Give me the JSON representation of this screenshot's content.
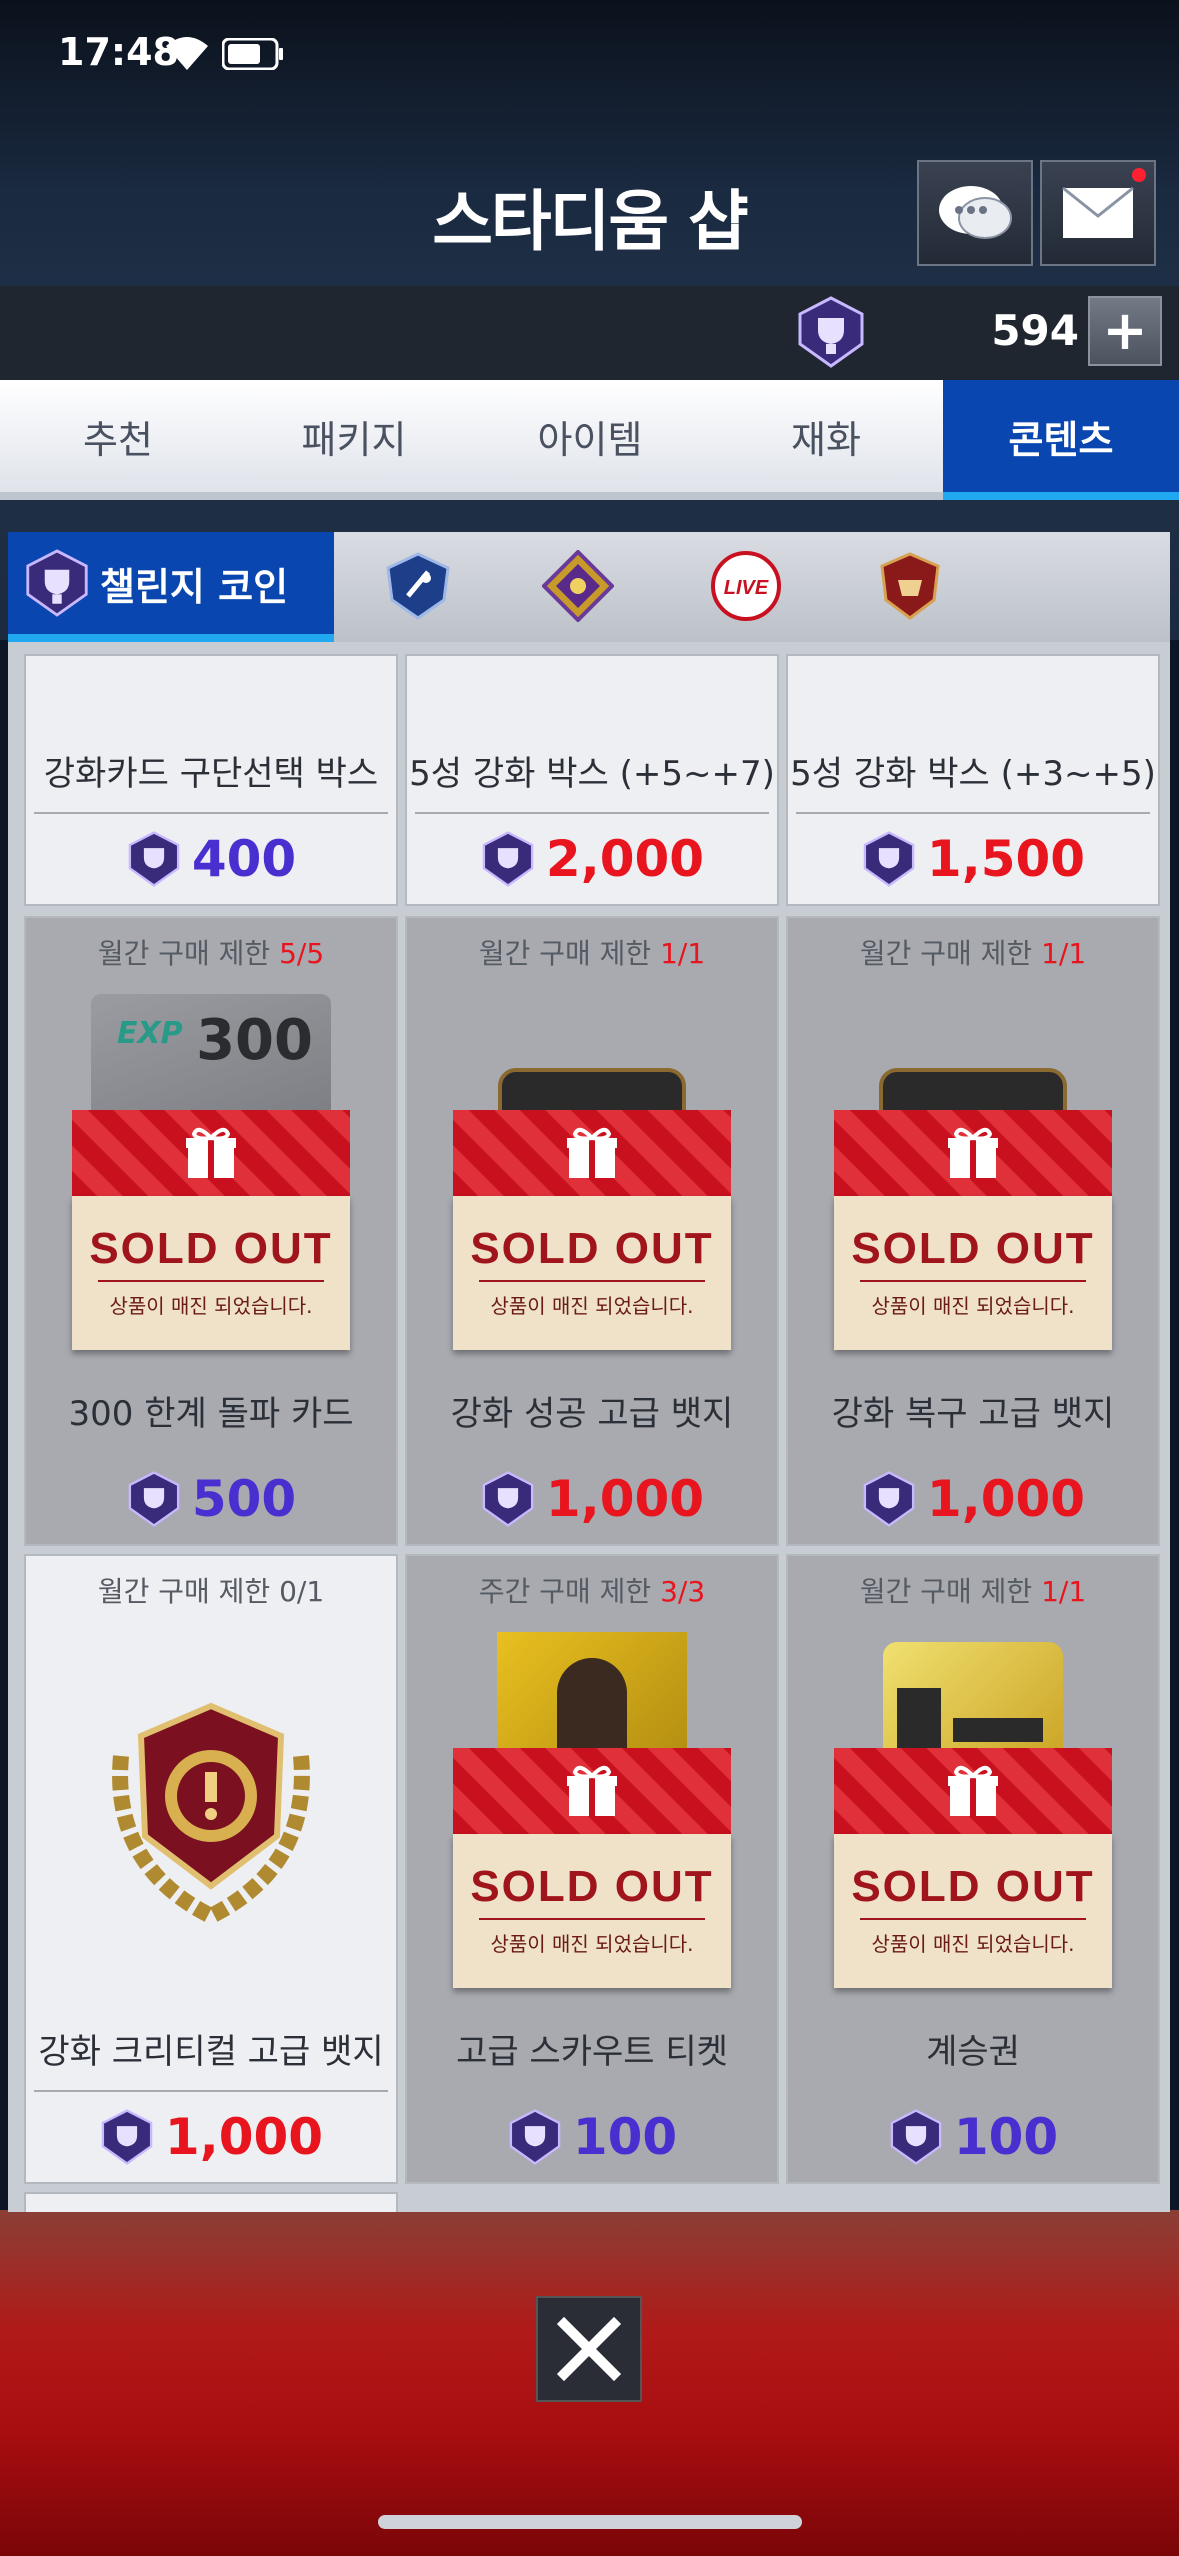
{
  "status": {
    "time": "17:48"
  },
  "header": {
    "title": "스타디움 샵"
  },
  "currency": {
    "amount": "594",
    "plus": "+"
  },
  "tabs": [
    {
      "label": "추천"
    },
    {
      "label": "패키지"
    },
    {
      "label": "아이템"
    },
    {
      "label": "재화"
    },
    {
      "label": "콘텐츠",
      "active": true
    }
  ],
  "subtabs": {
    "active_label": "챌린지 코인",
    "others": [
      "blue-crest-icon",
      "gold-purple-crest-icon",
      "live-badge-icon",
      "red-crest-icon"
    ],
    "live_text": "LIVE"
  },
  "items": [
    {
      "name": "강화카드 구단선택 박스",
      "price": "400",
      "price_color": "purple",
      "limit": "",
      "sold_out": false
    },
    {
      "name": "5성 강화 박스 (+5~+7)",
      "price": "2,000",
      "price_color": "red",
      "limit": "",
      "sold_out": false
    },
    {
      "name": "5성 강화 박스 (+3~+5)",
      "price": "1,500",
      "price_color": "red",
      "limit": "",
      "sold_out": false
    },
    {
      "name": "300 한계 돌파 카드",
      "price": "500",
      "price_color": "purple",
      "limit_label": "월간 구매 제한 ",
      "limit_used": "5",
      "limit_max": "5",
      "sold_out": true,
      "art_text": "300",
      "art_exp": "EXP"
    },
    {
      "name": "강화 성공 고급 뱃지",
      "price": "1,000",
      "price_color": "red",
      "limit_label": "월간 구매 제한 ",
      "limit_used": "1",
      "limit_max": "1",
      "sold_out": true
    },
    {
      "name": "강화 복구 고급 뱃지",
      "price": "1,000",
      "price_color": "red",
      "limit_label": "월간 구매 제한 ",
      "limit_used": "1",
      "limit_max": "1",
      "sold_out": true
    },
    {
      "name": "강화 크리티컬 고급 뱃지",
      "price": "1,000",
      "price_color": "red",
      "limit_text": "월간 구매 제한 0/1",
      "sold_out": false
    },
    {
      "name": "고급 스카우트 티켓",
      "price": "100",
      "price_color": "purple",
      "limit_label": "주간 구매 제한 ",
      "limit_used": "3",
      "limit_max": "3",
      "sold_out": true
    },
    {
      "name": "계승권",
      "price": "100",
      "price_color": "purple",
      "limit_label": "월간 구매 제한 ",
      "limit_used": "1",
      "limit_max": "1",
      "sold_out": true
    }
  ],
  "sold_out": {
    "title": "SOLD OUT",
    "subtitle": "상품이 매진 되었습니다."
  },
  "colors": {
    "accent_blue": "#0a46b0",
    "price_red": "#e8141e",
    "price_purple": "#4a2fd0"
  }
}
